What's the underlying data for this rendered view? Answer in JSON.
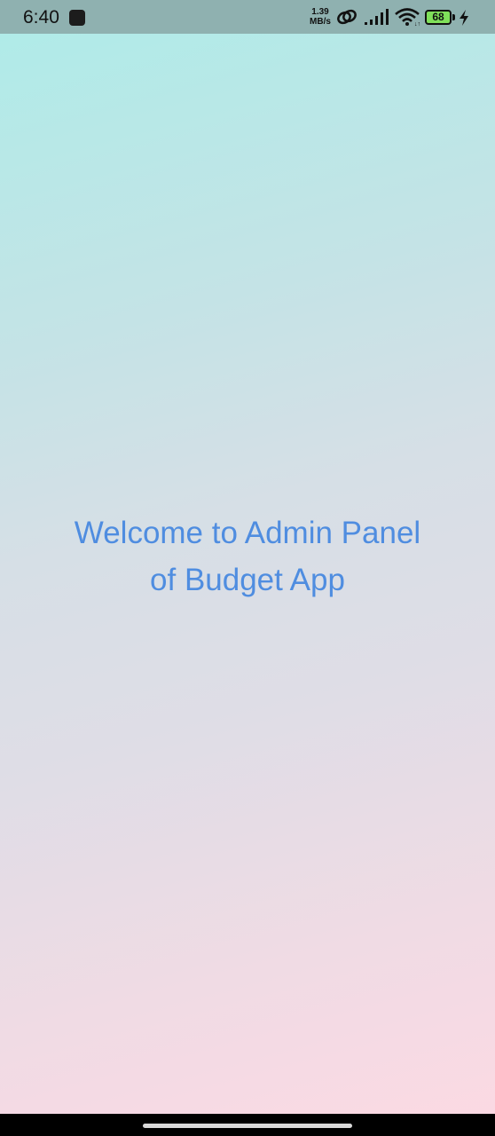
{
  "status_bar": {
    "time": "6:40",
    "network_speed_value": "1.39",
    "network_speed_unit": "MB/s",
    "battery_level": "68",
    "battery_color": "#7fe05a",
    "background": "#8fb1b0",
    "icons": [
      "app-notification-icon",
      "link-icon",
      "signal-icon",
      "wifi-icon",
      "battery-icon",
      "charging-bolt-icon"
    ]
  },
  "main": {
    "welcome_line1": "Welcome to Admin Panel",
    "welcome_line2": "of Budget App",
    "text_color": "#4f8de0",
    "gradient_top": "#aeece8",
    "gradient_bottom": "#fcd9e3"
  },
  "nav_bar": {
    "type": "gesture-navigation"
  }
}
